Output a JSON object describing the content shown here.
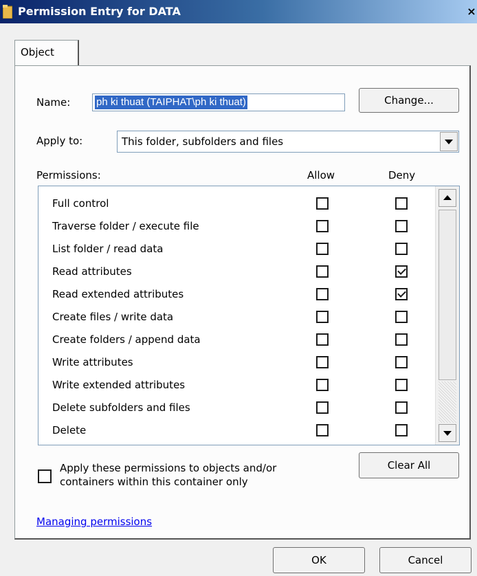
{
  "window": {
    "title": "Permission Entry for DATA",
    "close_glyph": "×"
  },
  "tabs": [
    {
      "label": "Object"
    }
  ],
  "name_field": {
    "label": "Name:",
    "value": "ph ki thuat (TAIPHAT\\ph ki thuat)"
  },
  "change_button": "Change...",
  "apply_to": {
    "label": "Apply to:",
    "value": "This folder, subfolders and files"
  },
  "permissions": {
    "header": "Permissions:",
    "allow_header": "Allow",
    "deny_header": "Deny",
    "rows": [
      {
        "name": "Full control",
        "allow": false,
        "deny": false
      },
      {
        "name": "Traverse folder / execute file",
        "allow": false,
        "deny": false
      },
      {
        "name": "List folder / read data",
        "allow": false,
        "deny": false
      },
      {
        "name": "Read attributes",
        "allow": false,
        "deny": true
      },
      {
        "name": "Read extended attributes",
        "allow": false,
        "deny": true
      },
      {
        "name": "Create files / write data",
        "allow": false,
        "deny": false
      },
      {
        "name": "Create folders / append data",
        "allow": false,
        "deny": false
      },
      {
        "name": "Write attributes",
        "allow": false,
        "deny": false
      },
      {
        "name": "Write extended attributes",
        "allow": false,
        "deny": false
      },
      {
        "name": "Delete subfolders and files",
        "allow": false,
        "deny": false
      },
      {
        "name": "Delete",
        "allow": false,
        "deny": false
      }
    ]
  },
  "apply_only": {
    "checked": false,
    "line1": "Apply these permissions to objects and/or",
    "line2": "containers within this container only"
  },
  "clear_all_button": "Clear All",
  "managing_link": "Managing permissions",
  "ok_button": "OK",
  "cancel_button": "Cancel",
  "colors": {
    "title_bar": "#0a246a",
    "selection": "#3168c6",
    "link": "#0000ee"
  }
}
